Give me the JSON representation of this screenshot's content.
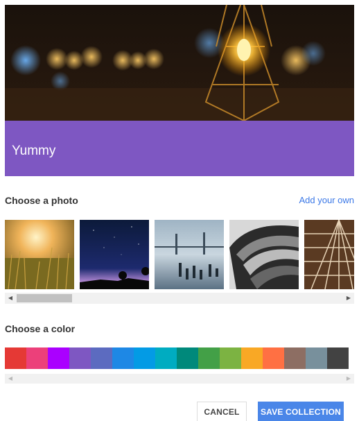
{
  "collection": {
    "title": "Yummy"
  },
  "photo_section": {
    "label": "Choose a photo",
    "add_link": "Add your own",
    "photos": [
      {
        "name": "grass-sunset-photo"
      },
      {
        "name": "night-sky-photo"
      },
      {
        "name": "bridge-pier-photo"
      },
      {
        "name": "metal-lens-photo"
      },
      {
        "name": "building-ceiling-photo"
      }
    ]
  },
  "color_section": {
    "label": "Choose a color",
    "colors": [
      "#e53935",
      "#ec407a",
      "#aa00ff",
      "#7e57c2",
      "#5c6bc0",
      "#1e88e5",
      "#039be5",
      "#00acc1",
      "#00897b",
      "#43a047",
      "#7cb342",
      "#f9a825",
      "#ff7043",
      "#8d6e63",
      "#78909c",
      "#424242"
    ]
  },
  "buttons": {
    "cancel": "CANCEL",
    "save": "SAVE COLLECTION"
  },
  "icons": {
    "scroll_left": "◀",
    "scroll_right": "▶"
  }
}
